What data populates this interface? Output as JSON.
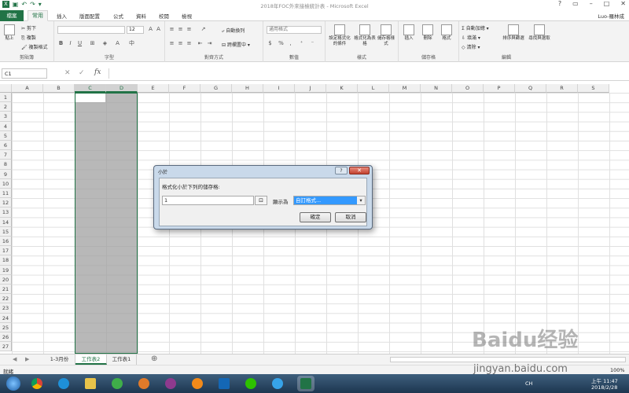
{
  "window": {
    "title": "2018年FOC外來接檢統計表 - Microsoft Excel",
    "user": "Luo-羅林成"
  },
  "tabs": [
    "檔案",
    "常用",
    "插入",
    "版面配置",
    "公式",
    "資料",
    "校閱",
    "檢視"
  ],
  "ribbon": {
    "clipboard": {
      "label": "剪貼簿",
      "paste": "貼上",
      "cut": "剪下",
      "copy": "複製",
      "format_painter": "複製格式"
    },
    "font": {
      "label": "字型",
      "size": "12"
    },
    "alignment": {
      "label": "對齊方式",
      "wrap": "自動換列",
      "merge": "跨欄置中"
    },
    "number": {
      "label": "數值",
      "format": "通用格式"
    },
    "styles": {
      "label": "樣式",
      "cond_format": "設定格式化的條件",
      "format_table": "格式化為表格",
      "cell_styles": "儲存格樣式"
    },
    "cells": {
      "label": "儲存格",
      "insert": "插入",
      "delete": "刪除",
      "format": "格式"
    },
    "editing": {
      "label": "編輯",
      "autosum": "自動加總",
      "fill": "填滿",
      "clear": "清除",
      "sort": "排序與篩選",
      "find": "尋找與選取"
    }
  },
  "formula_bar": {
    "name_box": "C1",
    "fx": "fx",
    "value": ""
  },
  "columns": [
    "A",
    "B",
    "C",
    "D",
    "E",
    "F",
    "G",
    "H",
    "I",
    "J",
    "K",
    "L",
    "M",
    "N",
    "O",
    "P",
    "Q",
    "R",
    "S"
  ],
  "rows": [
    "1",
    "2",
    "3",
    "4",
    "5",
    "6",
    "7",
    "8",
    "9",
    "10",
    "11",
    "12",
    "13",
    "14",
    "15",
    "16",
    "17",
    "18",
    "19",
    "20",
    "21",
    "22",
    "23",
    "24",
    "25",
    "26",
    "27"
  ],
  "sheets": [
    "1-3月份",
    "工作表2",
    "工作表1"
  ],
  "active_sheet": "工作表2",
  "status": {
    "mode": "就緒",
    "zoom": "100%"
  },
  "dialog": {
    "title": "小於",
    "prompt": "格式化小於下列的儲存格:",
    "value": "1",
    "display_as": "顯示為",
    "format_option": "自訂格式...",
    "ok": "確定",
    "cancel": "取消"
  },
  "taskbar": {
    "time": "上午 11:47",
    "date": "2018/2/28",
    "lang": "CH"
  },
  "watermark": {
    "logo": "Baidu经验",
    "url": "jingyan.baidu.com"
  }
}
